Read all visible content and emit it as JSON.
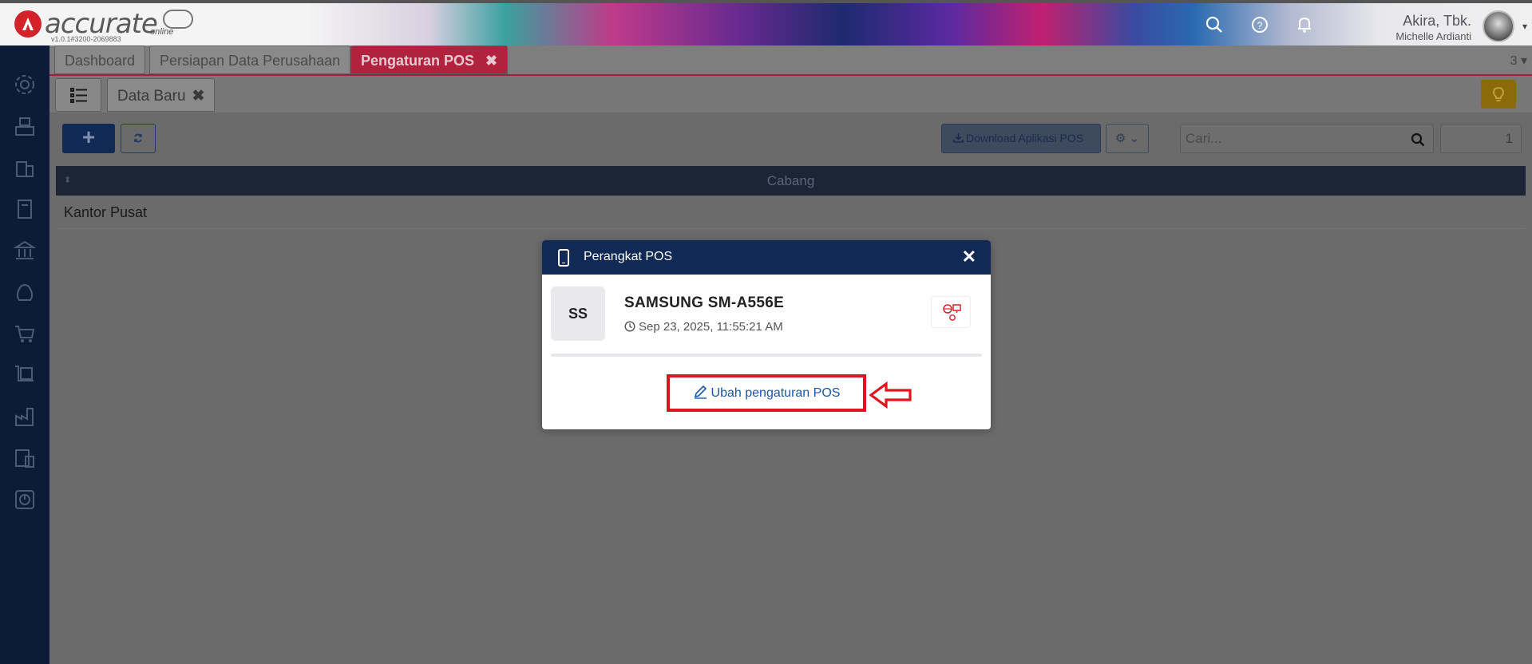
{
  "app": {
    "brand": "accurate",
    "brand_sub": "online",
    "version": "v1.0.1#3200-2069883"
  },
  "header": {
    "company": "Akira, Tbk.",
    "user": "Michelle Ardianti"
  },
  "tabs": [
    {
      "label": "Dashboard"
    },
    {
      "label": "Persiapan Data Perusahaan"
    },
    {
      "label": "Pengaturan POS",
      "close": "✖"
    }
  ],
  "tab_count": "3",
  "subtabs": {
    "label": "Data Baru",
    "close": "✖"
  },
  "toolbar": {
    "add": "+",
    "download_label": "Download Aplikasi POS",
    "search_placeholder": "Cari...",
    "page": "1"
  },
  "table": {
    "column": "Cabang",
    "rows": [
      "Kantor Pusat"
    ]
  },
  "modal": {
    "title": "Perangkat POS",
    "close": "✕",
    "device": {
      "initials": "SS",
      "name": "SAMSUNG SM-A556E",
      "time": "Sep 23, 2025, 11:55:21 AM"
    },
    "edit_label": "Ubah pengaturan POS"
  },
  "colors": {
    "brand_red": "#d2232a",
    "navy": "#102a55",
    "sidebar": "#0d1a38",
    "highlight_red": "#e0141e",
    "link_blue": "#1a56a6"
  },
  "sidebar_icons": [
    "settings-icon",
    "cash-register-icon",
    "building-icon",
    "book-icon",
    "bank-icon",
    "money-bag-icon",
    "cart-icon",
    "delivery-icon",
    "factory-icon",
    "tax-icon",
    "report-icon"
  ]
}
